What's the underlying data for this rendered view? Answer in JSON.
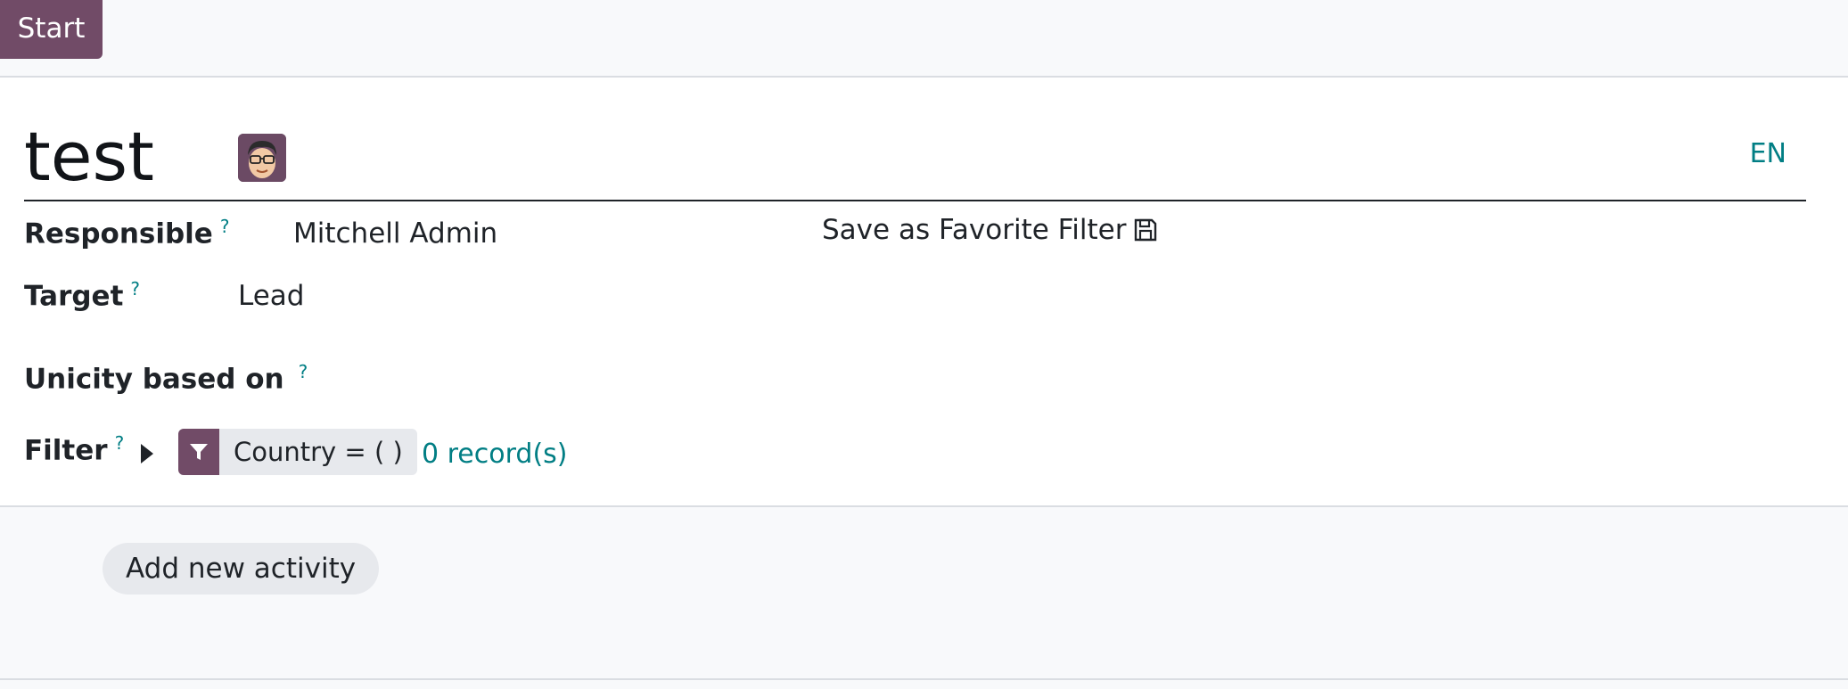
{
  "topbar": {
    "start_label": "Start"
  },
  "form": {
    "title": "test",
    "lang": "EN",
    "fields": {
      "responsible": {
        "label": "Responsible",
        "help": "?",
        "value": "Mitchell Admin"
      },
      "target": {
        "label": "Target",
        "help": "?",
        "value": "Lead"
      },
      "unicity": {
        "label": "Unicity based on",
        "help": "?",
        "value": ""
      },
      "filter": {
        "label": "Filter",
        "help": "?",
        "chip": "Country = ( )",
        "records": "0 record(s)"
      }
    },
    "save_favorite": "Save as Favorite Filter"
  },
  "activities": {
    "add_label": "Add new activity"
  },
  "colors": {
    "brand": "#714b67",
    "link": "#017e84"
  },
  "icons": {
    "avatar": "user-avatar-icon",
    "save": "floppy-disk-icon",
    "filter": "funnel-icon",
    "caret": "caret-right-icon"
  }
}
